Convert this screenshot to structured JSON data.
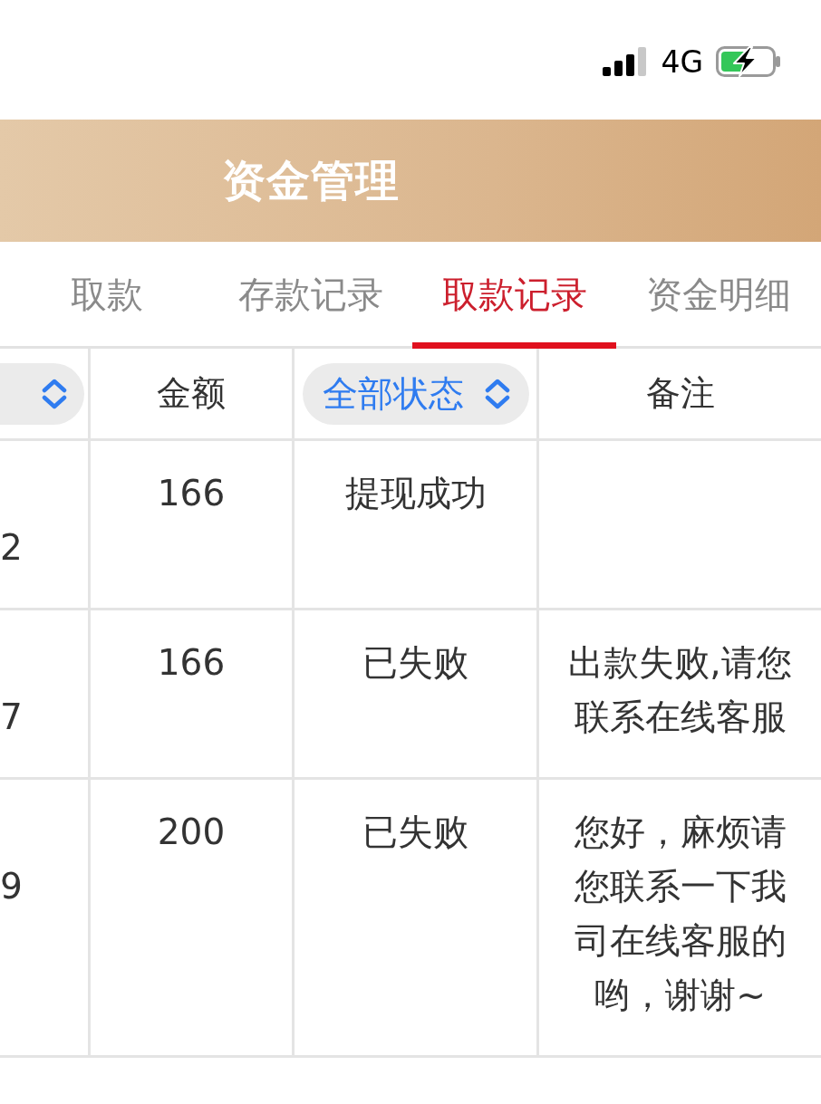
{
  "status_bar": {
    "network": "4G"
  },
  "header": {
    "title": "资金管理"
  },
  "tabs": [
    {
      "label": "取款",
      "selected": false
    },
    {
      "label": "存款记录",
      "selected": false
    },
    {
      "label": "取款记录",
      "selected": true
    },
    {
      "label": "资金明细",
      "selected": false
    }
  ],
  "table": {
    "columns": [
      {
        "kind": "filter"
      },
      {
        "kind": "text",
        "label": "金额"
      },
      {
        "kind": "filter",
        "label": "全部状态"
      },
      {
        "kind": "text",
        "label": "备注"
      }
    ],
    "rows": [
      {
        "column_1": "2",
        "amount": "166",
        "status": "提现成功"
      },
      {
        "column_1": "7",
        "amount": "166",
        "status": "已失败",
        "note": "出款失败,请您联系在线客服"
      },
      {
        "column_1": "9",
        "amount": "200",
        "status": "已失败",
        "note": "您好，麻烦请您联系一下我司在线客服的哟，谢谢~"
      }
    ]
  }
}
